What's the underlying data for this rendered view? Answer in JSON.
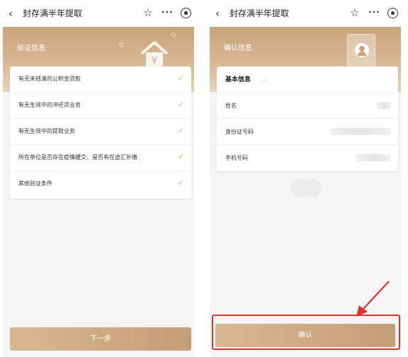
{
  "left": {
    "navbar": {
      "back_icon": "chevron-left-icon",
      "title": "封存满半年提取",
      "star_icon": "star-outline-icon",
      "more_icon": "more-dots-icon",
      "target_icon": "target-icon"
    },
    "banner": {
      "title": "验证信息",
      "icon": "house-yuan-icon"
    },
    "checks": [
      {
        "label": "有无未结清的公积金贷款",
        "status": "passed"
      },
      {
        "label": "有无生效中的冲还贷业务",
        "status": "passed"
      },
      {
        "label": "有无生效中的提取业务",
        "status": "passed"
      },
      {
        "label": "所在单位是否存在疫情缓交、是否有在途汇补缴",
        "status": "passed"
      },
      {
        "label": "其他验证条件",
        "status": "passed"
      }
    ],
    "next_button": "下一步"
  },
  "right": {
    "navbar": {
      "back_icon": "chevron-left-icon",
      "title": "封存满半年提取",
      "star_icon": "star-outline-icon",
      "more_icon": "more-dots-icon",
      "target_icon": "target-icon"
    },
    "banner": {
      "title": "确认信息",
      "icon": "id-card-icon"
    },
    "basic_info": {
      "heading": "基本信息",
      "rows": [
        {
          "label": "姓名"
        },
        {
          "label": "身份证号码"
        },
        {
          "label": "手机号码"
        }
      ]
    },
    "confirm_button": "确认"
  },
  "colors": {
    "accent": "#c9a37a",
    "check": "#b8cc8a",
    "highlight": "#e0302a"
  },
  "glyphs": {
    "back": "‹",
    "star": "☆",
    "more": "···",
    "check": "✓"
  }
}
